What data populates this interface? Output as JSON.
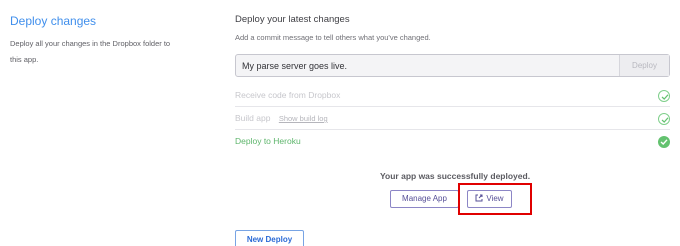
{
  "left": {
    "title": "Deploy changes",
    "description": "Deploy all your changes in the Dropbox folder to this app."
  },
  "main": {
    "title": "Deploy your latest changes",
    "subtitle": "Add a commit message to tell others what you've changed.",
    "commit_value": "My parse server goes live.",
    "deploy_label": "Deploy"
  },
  "steps": [
    {
      "label": "Receive code from Dropbox",
      "status": "done"
    },
    {
      "label": "Build app",
      "link": "Show build log",
      "status": "done"
    },
    {
      "label": "Deploy to Heroku",
      "status": "success"
    }
  ],
  "result": {
    "message": "Your app was successfully deployed.",
    "manage_label": "Manage App",
    "view_label": "View"
  },
  "new_deploy_label": "New Deploy",
  "colors": {
    "accent_blue": "#408fec",
    "success_green": "#63c26f",
    "button_purple": "#564f97",
    "highlight_red": "#e00000"
  }
}
